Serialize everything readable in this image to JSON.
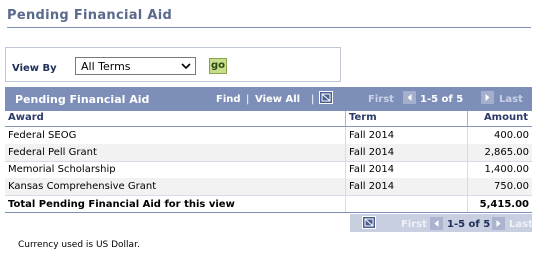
{
  "page": {
    "title": "Pending Financial Aid"
  },
  "view_by": {
    "label": "View By",
    "selected": "All Terms",
    "go_label": "go"
  },
  "grid": {
    "title": "Pending Financial Aid",
    "find_label": "Find",
    "view_all_label": "View All",
    "first_label": "First",
    "range_text": "1-5 of 5",
    "last_label": "Last",
    "columns": {
      "award": "Award",
      "term": "Term",
      "amount": "Amount"
    },
    "rows": [
      {
        "award": "Federal SEOG",
        "term": "Fall 2014",
        "amount": "400.00"
      },
      {
        "award": "Federal Pell Grant",
        "term": "Fall 2014",
        "amount": "2,865.00"
      },
      {
        "award": "Memorial Scholarship",
        "term": "Fall 2014",
        "amount": "1,400.00"
      },
      {
        "award": "Kansas Comprehensive Grant",
        "term": "Fall 2014",
        "amount": "750.00"
      }
    ],
    "total": {
      "label": "Total Pending Financial Aid for this view",
      "amount": "5,415.00"
    },
    "footer": {
      "first_label": "First",
      "range_text": "1-5 of 5",
      "last_label": "Last"
    }
  },
  "note": "Currency used is US Dollar.",
  "icons": {
    "zoom": "grid-zoom-icon",
    "prev": "left-arrow-icon",
    "next": "right-arrow-icon",
    "dropdown": "chevron-down-icon"
  },
  "colors": {
    "header_bg": "#7d8fb8",
    "title": "#5a6a8c",
    "go_button": "#c7dd8a"
  }
}
